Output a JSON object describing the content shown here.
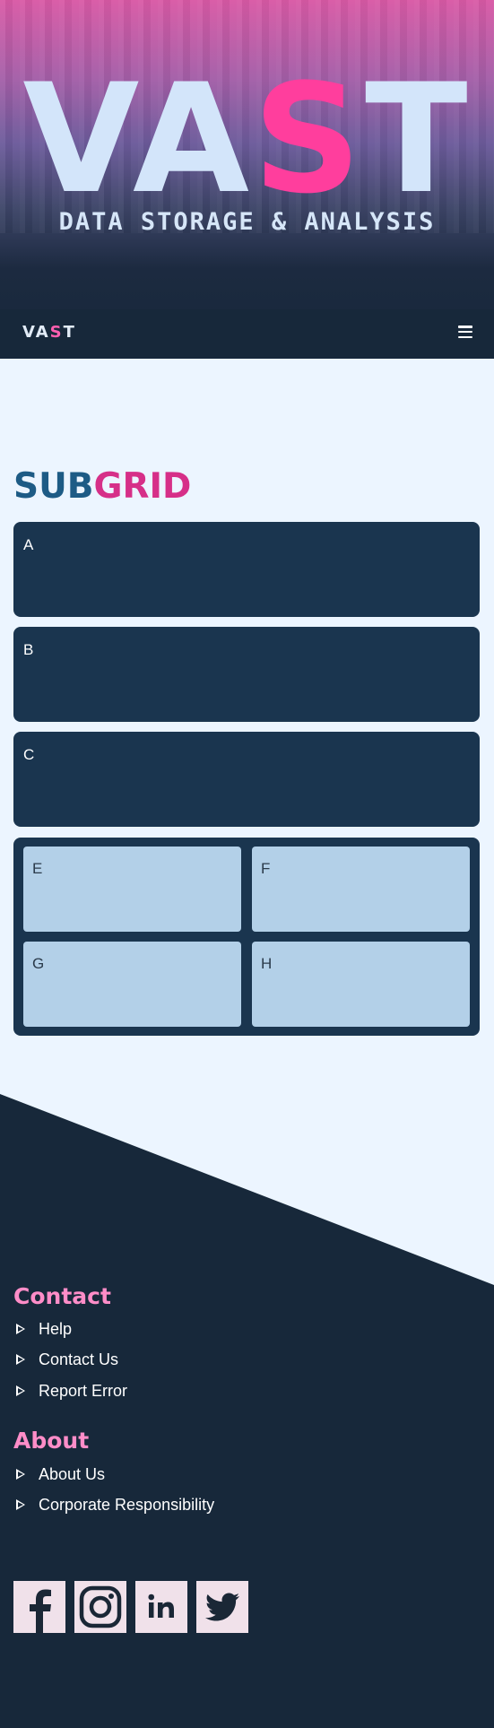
{
  "hero": {
    "title_pre": "VA",
    "title_accent": "S",
    "title_post": "T",
    "subtitle": "DATA STORAGE & ANALYSIS"
  },
  "navbar": {
    "logo_pre": "VA",
    "logo_accent": "S",
    "logo_post": "T",
    "menu_icon": "hamburger-menu-icon"
  },
  "main": {
    "title_part1": "SUB",
    "title_part2": "GRID",
    "cards": [
      {
        "label": "A"
      },
      {
        "label": "B"
      },
      {
        "label": "C"
      }
    ],
    "subgrid": [
      {
        "label": "E"
      },
      {
        "label": "F"
      },
      {
        "label": "G"
      },
      {
        "label": "H"
      }
    ]
  },
  "footer": {
    "contact": {
      "heading": "Contact",
      "links": [
        "Help",
        "Contact Us",
        "Report Error"
      ]
    },
    "about": {
      "heading": "About",
      "links": [
        "About Us",
        "Corporate Responsibility"
      ]
    },
    "social": [
      "facebook-icon",
      "instagram-icon",
      "linkedin-icon",
      "twitter-icon"
    ]
  },
  "colors": {
    "background": "#ecf5ff",
    "dark": "#17283a",
    "card": "#1a354f",
    "subcell": "#b3d0e8",
    "accent_pink": "#ff3e9d",
    "title_blue": "#1d5b85",
    "title_pink": "#d62f88",
    "footer_heading": "#ff8dc8"
  }
}
